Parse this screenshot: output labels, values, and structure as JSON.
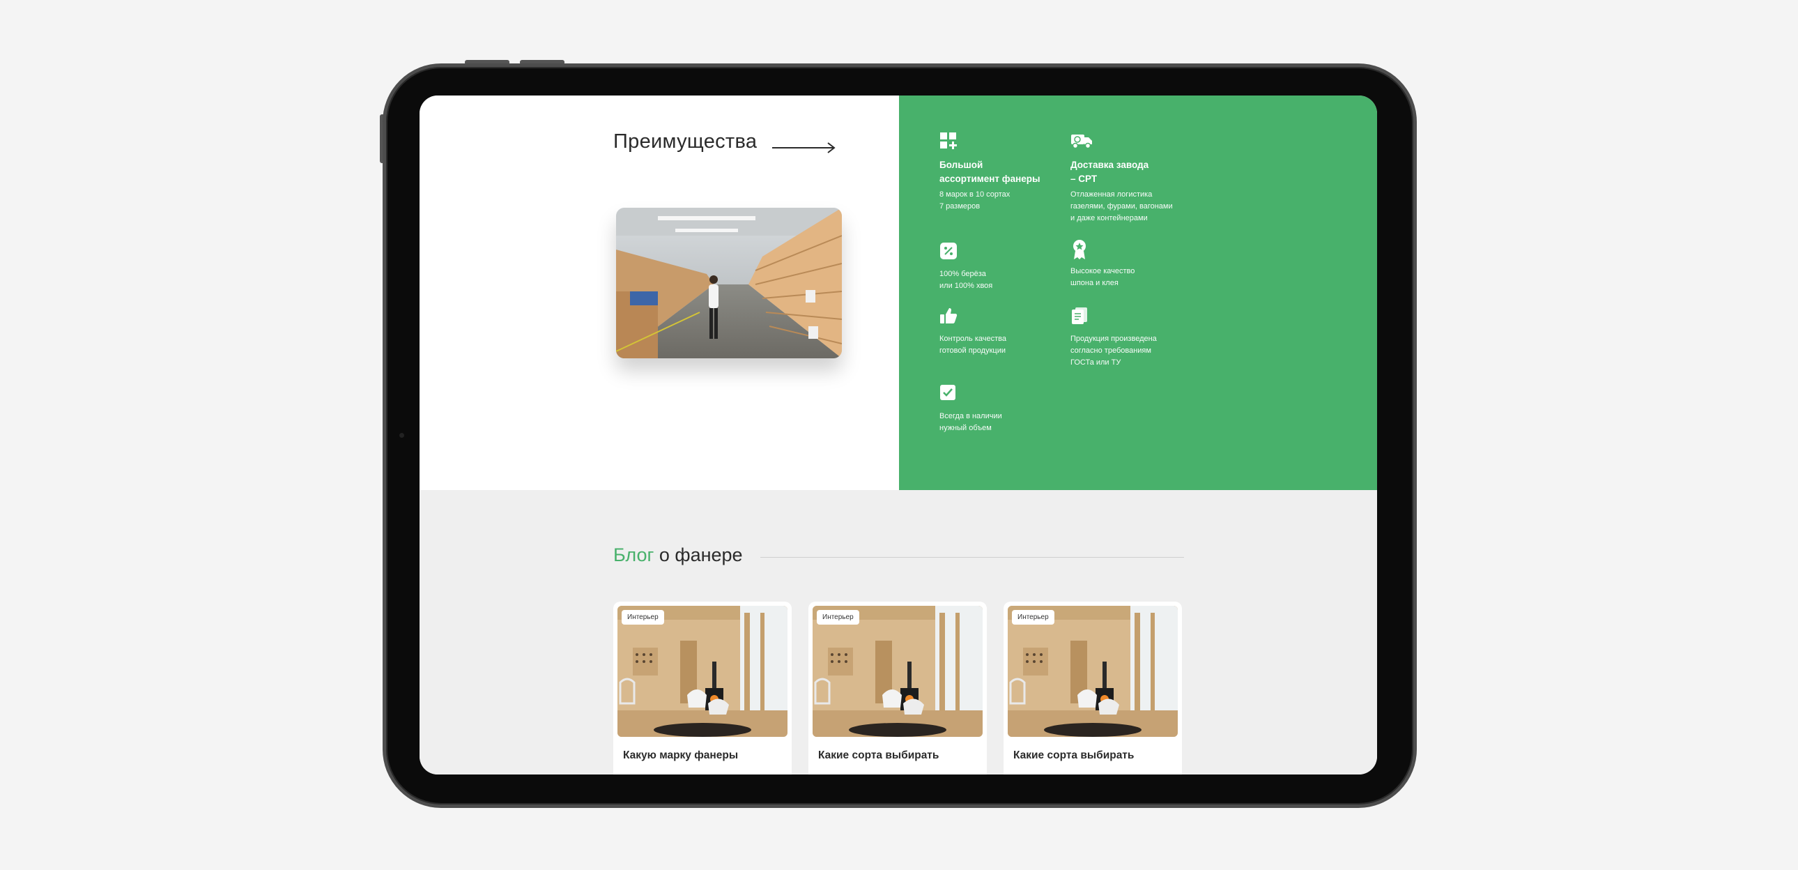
{
  "advantages": {
    "title": "Преимущества",
    "features": [
      {
        "icon": "grid-plus-icon",
        "title": "Большой\nассортимент фанеры",
        "desc": "8 марок в 10 сортах\n7 размеров"
      },
      {
        "icon": "delivery-truck-icon",
        "title": "Доставка завода\n– СРТ",
        "desc": "Отлаженная логистика\nгазелями, фурами, вагонами\nи даже контейнерами"
      },
      {
        "icon": "percent-badge-icon",
        "title": "",
        "desc": "100% берёза\nили 100% хвоя"
      },
      {
        "icon": "award-medal-icon",
        "title": "",
        "desc": "Высокое качество\nшпона и клея"
      },
      {
        "icon": "thumbs-up-icon",
        "title": "",
        "desc": "Контроль качества\nготовой продукции"
      },
      {
        "icon": "documents-icon",
        "title": "",
        "desc": "Продукция произведена\nсогласно требованиям\nГОСТа или ТУ"
      },
      {
        "icon": "checkbox-icon",
        "title": "",
        "desc": "Всегда в наличии\nнужный объем"
      }
    ]
  },
  "blog": {
    "title_accent": "Блог",
    "title_rest": " о фанере",
    "cards": [
      {
        "tag": "Интерьер",
        "title": "Какую марку фанеры"
      },
      {
        "tag": "Интерьер",
        "title": "Какие сорта выбирать"
      },
      {
        "tag": "Интерьер",
        "title": "Какие сорта выбирать"
      }
    ]
  },
  "colors": {
    "accent": "#48b16b",
    "text": "#2b2b2b",
    "section_bg": "#efefef"
  }
}
